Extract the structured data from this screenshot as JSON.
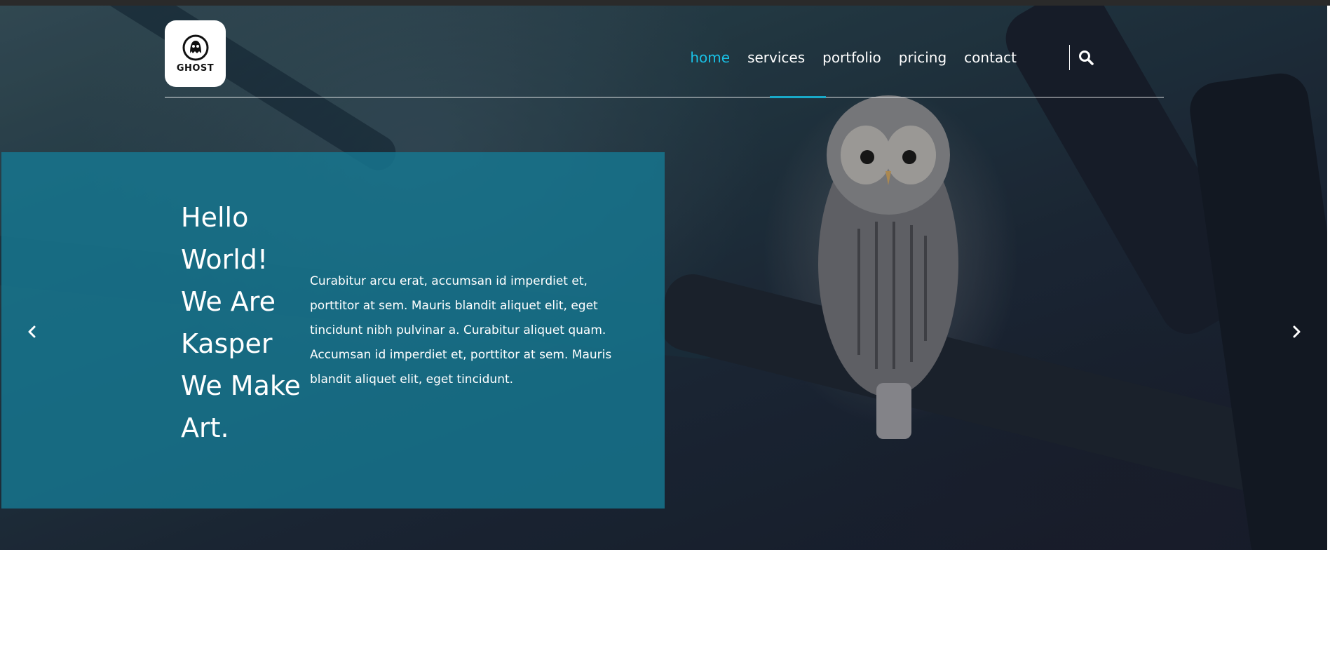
{
  "nav": {
    "items": [
      "home",
      "services",
      "portfolio",
      "pricing",
      "contact"
    ],
    "active": "home"
  },
  "logo": {
    "text": "GHOST"
  },
  "hero": {
    "headline": "Hello World! We Are Kasper We Make Art.",
    "paragraph": "Curabitur arcu erat, accumsan id imperdiet et, porttitor at sem. Mauris blandit aliquet elit, eget tincidunt nibh pulvinar a. Curabitur aliquet quam. Accumsan id imperdiet et, porttitor at sem. Mauris blandit aliquet elit, eget tincidunt."
  },
  "icons": {
    "search": "search-icon",
    "prev": "chevron-left-icon",
    "next": "chevron-right-icon"
  },
  "colors": {
    "accent": "#19c1e6",
    "panel": "#167891"
  }
}
